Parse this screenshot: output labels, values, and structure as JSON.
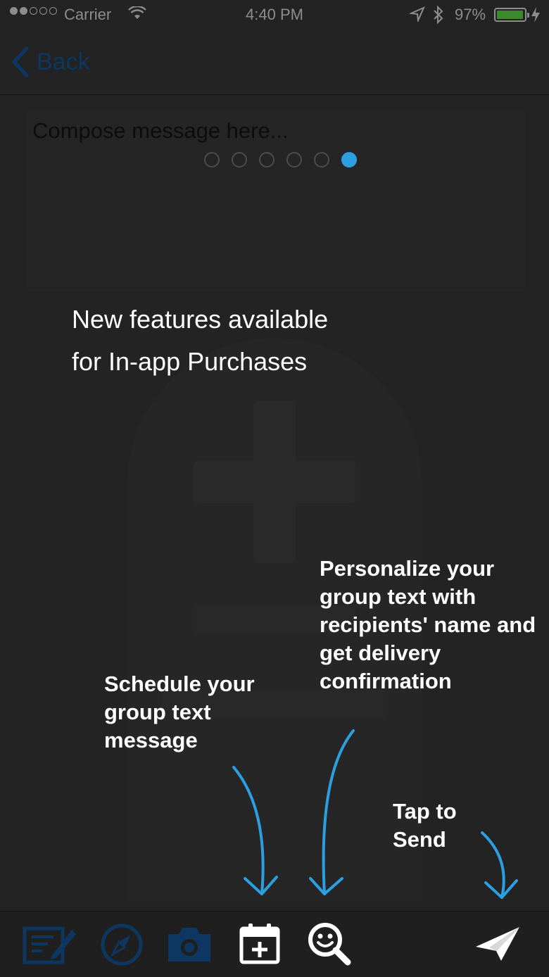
{
  "status_bar": {
    "carrier": "Carrier",
    "time": "4:40 PM",
    "battery_percent": "97%",
    "battery_level": 0.97,
    "signal_bars_filled": 2,
    "signal_bars_total": 5
  },
  "nav": {
    "back_label": "Back"
  },
  "compose": {
    "placeholder": "Compose message here...",
    "page_count": 6,
    "active_page": 6
  },
  "overlay": {
    "headline_line1": "New features available",
    "headline_line2": "for In-app Purchases",
    "schedule_tip": "Schedule your group text message",
    "personalize_tip": "Personalize your group text with recipients' name and get delivery confirmation",
    "send_tip": "Tap to Send"
  },
  "toolbar": {
    "icons": [
      "compose-template-icon",
      "compass-icon",
      "camera-icon",
      "calendar-add-icon",
      "personalize-search-icon",
      "send-icon"
    ]
  },
  "colors": {
    "accent": "#2b9fe0",
    "dim_icon": "#0d3760",
    "background": "#232323"
  }
}
